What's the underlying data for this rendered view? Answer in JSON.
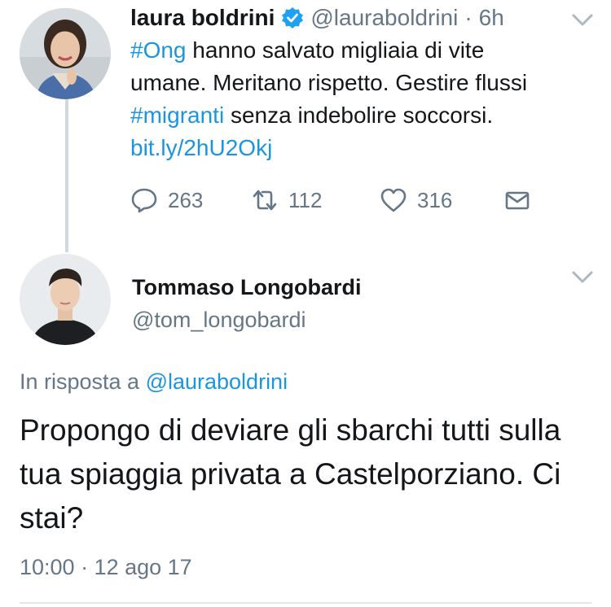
{
  "colors": {
    "link": "#1b95e0",
    "muted": "#657786",
    "text": "#14171a",
    "verified": "#1da1f2",
    "divider": "#e1e8ed"
  },
  "tweet1": {
    "display_name": "laura boldrini",
    "verified_icon": "verified-badge-icon",
    "handle": "@lauraboldrini",
    "separator": "·",
    "time": "6h",
    "text_parts": {
      "hashtag1": "#Ong",
      "text1": " hanno salvato migliaia di vite umane. Meritano rispetto. Gestire flussi ",
      "hashtag2": "#migranti",
      "text2": " senza indebolire soccorsi. ",
      "link": "bit.ly/2hU2Okj"
    },
    "actions": {
      "reply_icon": "reply-icon",
      "reply_count": "263",
      "retweet_icon": "retweet-icon",
      "retweet_count": "112",
      "like_icon": "heart-icon",
      "like_count": "316",
      "dm_icon": "envelope-icon"
    }
  },
  "tweet2": {
    "display_name": "Tommaso Longobardi",
    "handle": "@tom_longobardi",
    "reply_prefix": "In risposta a ",
    "reply_handle": "@lauraboldrini",
    "text": "Propongo di deviare gli sbarchi tutti sulla tua spiaggia privata a Castelporziano. Ci stai?",
    "timestamp": "10:00 · 12 ago 17"
  }
}
